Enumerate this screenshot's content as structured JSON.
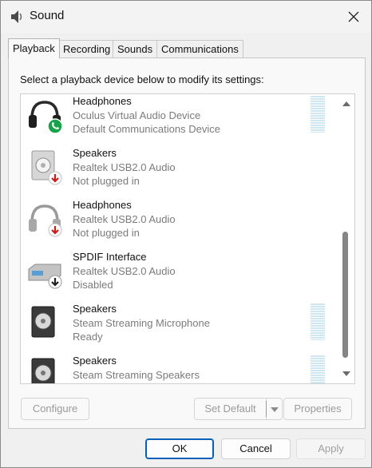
{
  "window": {
    "title": "Sound",
    "title_icon": "speaker-icon",
    "close_icon": "close-icon"
  },
  "tabs": [
    {
      "label": "Playback",
      "active": true
    },
    {
      "label": "Recording",
      "active": false
    },
    {
      "label": "Sounds",
      "active": false
    },
    {
      "label": "Communications",
      "active": false
    }
  ],
  "playback": {
    "instruction": "Select a playback device below to modify its settings:",
    "devices": [
      {
        "name": "Headphones",
        "driver": "Oculus Virtual Audio Device",
        "status": "Default Communications Device",
        "icon": "headphones-icon",
        "badge": "phone-badge-icon"
      },
      {
        "name": "Speakers",
        "driver": "Realtek USB2.0 Audio",
        "status": "Not plugged in",
        "icon": "speaker-box-icon",
        "badge": "unplugged-badge-icon"
      },
      {
        "name": "Headphones",
        "driver": "Realtek USB2.0 Audio",
        "status": "Not plugged in",
        "icon": "headphones-icon",
        "badge": "unplugged-badge-icon"
      },
      {
        "name": "SPDIF Interface",
        "driver": "Realtek USB2.0 Audio",
        "status": "Disabled",
        "icon": "spdif-icon",
        "badge": "disabled-badge-icon"
      },
      {
        "name": "Speakers",
        "driver": "Steam Streaming Microphone",
        "status": "Ready",
        "icon": "speaker-box-icon",
        "badge": ""
      },
      {
        "name": "Speakers",
        "driver": "Steam Streaming Speakers",
        "status": "",
        "icon": "speaker-box-icon",
        "badge": ""
      }
    ],
    "buttons": {
      "configure": "Configure",
      "set_default": "Set Default",
      "properties": "Properties"
    }
  },
  "dialog_buttons": {
    "ok": "OK",
    "cancel": "Cancel",
    "apply": "Apply"
  },
  "colors": {
    "accent": "#005fb8",
    "phone_badge": "#16a34a",
    "unplugged_badge": "#d11a1a",
    "level_meter": "#cfe6f3"
  }
}
